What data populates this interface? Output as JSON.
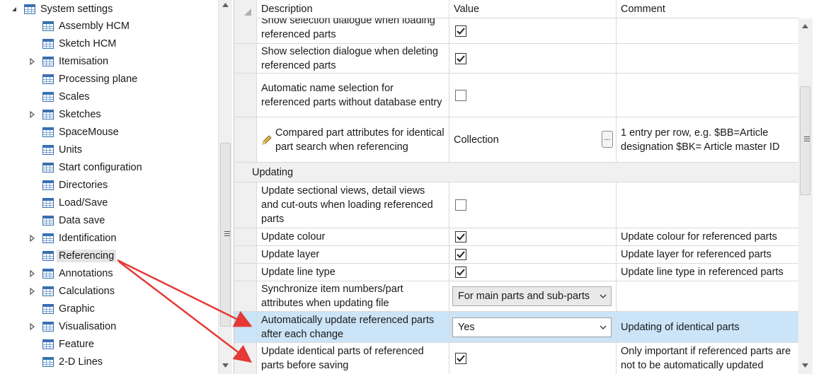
{
  "tree": {
    "root_label": "System settings",
    "items": [
      {
        "label": "Assembly HCM",
        "expandable": false
      },
      {
        "label": "Sketch HCM",
        "expandable": false
      },
      {
        "label": "Itemisation",
        "expandable": true
      },
      {
        "label": "Processing plane",
        "expandable": false
      },
      {
        "label": "Scales",
        "expandable": false
      },
      {
        "label": "Sketches",
        "expandable": true
      },
      {
        "label": "SpaceMouse",
        "expandable": false
      },
      {
        "label": "Units",
        "expandable": false
      },
      {
        "label": "Start configuration",
        "expandable": false
      },
      {
        "label": "Directories",
        "expandable": false
      },
      {
        "label": "Load/Save",
        "expandable": false
      },
      {
        "label": "Data save",
        "expandable": false
      },
      {
        "label": "Identification",
        "expandable": true
      },
      {
        "label": "Referencing",
        "expandable": false,
        "selected": true
      },
      {
        "label": "Annotations",
        "expandable": true
      },
      {
        "label": "Calculations",
        "expandable": true
      },
      {
        "label": "Graphic",
        "expandable": false
      },
      {
        "label": "Visualisation",
        "expandable": true
      },
      {
        "label": "Feature",
        "expandable": false
      },
      {
        "label": "2-D Lines",
        "expandable": false
      }
    ]
  },
  "grid": {
    "columns": {
      "description": "Description",
      "value": "Value",
      "comment": "Comment"
    },
    "rows_top": [
      {
        "desc": "Show selection dialogue when loading referenced parts",
        "value_type": "checkbox",
        "checked": true,
        "comment": ""
      },
      {
        "desc": "Show selection dialogue when deleting referenced parts",
        "value_type": "checkbox",
        "checked": true,
        "comment": ""
      },
      {
        "desc": "Automatic name selection for referenced parts without database entry",
        "value_type": "checkbox",
        "checked": false,
        "comment": ""
      },
      {
        "desc": "Compared part attributes for identical part search when referencing",
        "value_type": "text",
        "value": "Collection",
        "button": "...",
        "comment": "1 entry per row, e.g. $BB=Article designation $BK= Article master ID"
      }
    ],
    "section_label": "Updating",
    "rows_bottom": [
      {
        "desc": "Update sectional views, detail views and cut-outs when loading referenced parts",
        "value_type": "checkbox",
        "checked": false,
        "comment": ""
      },
      {
        "desc": "Update colour",
        "value_type": "checkbox",
        "checked": true,
        "comment": "Update colour for referenced parts"
      },
      {
        "desc": "Update layer",
        "value_type": "checkbox",
        "checked": true,
        "comment": "Update layer for referenced parts"
      },
      {
        "desc": "Update line type",
        "value_type": "checkbox",
        "checked": true,
        "comment": "Update line type in referenced parts"
      },
      {
        "desc": "Synchronize item numbers/part attributes when updating file",
        "value_type": "select",
        "value": "For main parts and sub-parts",
        "comment": ""
      },
      {
        "desc": "Automatically update referenced parts after each change",
        "value_type": "select",
        "value": "Yes",
        "comment": "Updating of identical parts",
        "highlighted": true
      },
      {
        "desc": "Update identical parts of referenced parts before saving",
        "value_type": "checkbox",
        "checked": true,
        "comment": "Only important if referenced parts are not to be automatically updated"
      }
    ]
  },
  "colors": {
    "highlight_row": "#cce4f7",
    "annotation_arrow": "#e53935",
    "tree_icon": "#3a6fb0"
  },
  "icons": {
    "tree_node": "settings-table-icon",
    "expander": "chevron-right-icon",
    "edit": "pencil-icon"
  }
}
